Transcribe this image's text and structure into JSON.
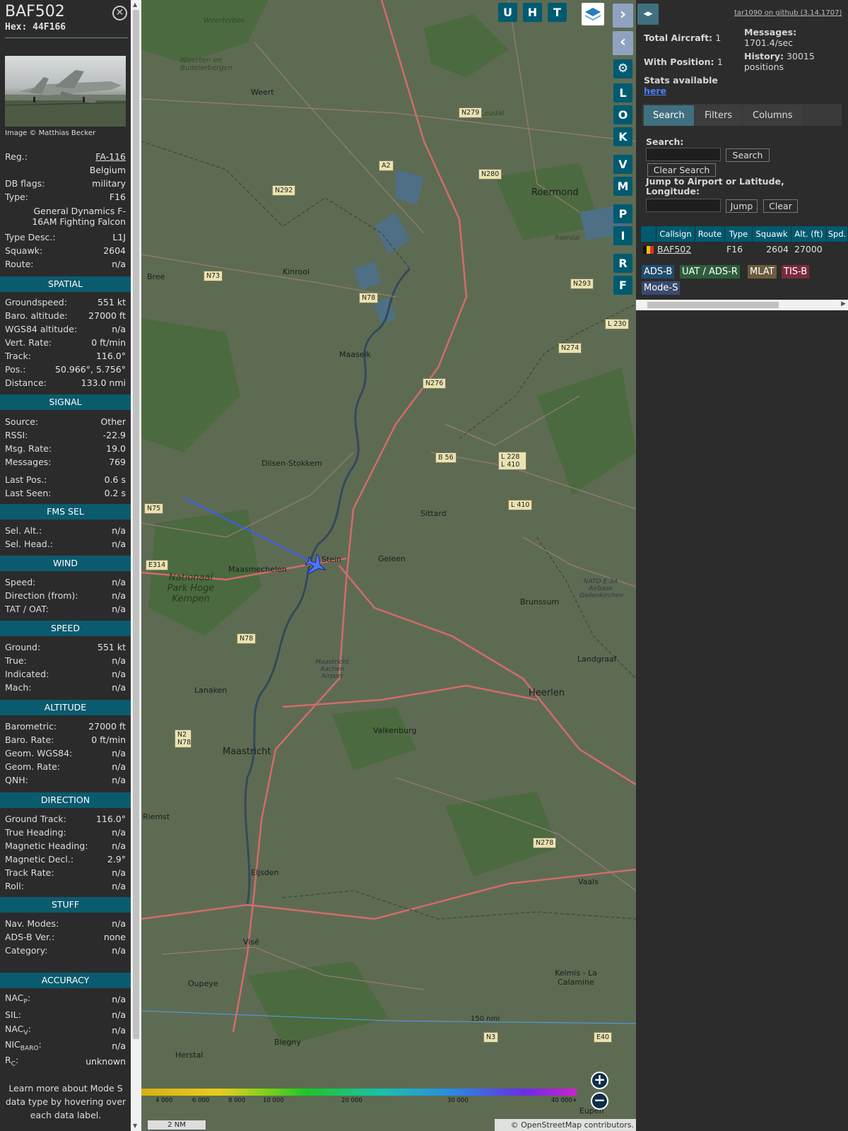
{
  "sidebar": {
    "callsign": "BAF502",
    "hex_label": "Hex:",
    "hex_value": "44F166",
    "photo_credit": "Image © Matthias Becker",
    "top_rows": [
      {
        "label": "Reg.:",
        "value": "FA-116"
      },
      {
        "label": "",
        "value": "Belgium"
      },
      {
        "label": "DB flags:",
        "value": "military"
      },
      {
        "label": "Type:",
        "value": "F16"
      }
    ],
    "type_full": "General Dynamics F-16AM Fighting Falcon",
    "desc_rows": [
      {
        "label": "Type Desc.:",
        "value": "L1J"
      },
      {
        "label": "Squawk:",
        "value": "2604"
      },
      {
        "label": "Route:",
        "value": "n/a"
      }
    ],
    "sections": {
      "spatial": "SPATIAL",
      "signal": "SIGNAL",
      "fms": "FMS SEL",
      "wind": "WIND",
      "speed": "SPEED",
      "altitude": "ALTITUDE",
      "direction": "DIRECTION",
      "stuff": "STUFF",
      "accuracy": "ACCURACY"
    },
    "spatial": [
      {
        "label": "Groundspeed:",
        "value": "551 kt"
      },
      {
        "label": "Baro. altitude:",
        "value": "27000 ft"
      },
      {
        "label": "WGS84 altitude:",
        "value": "n/a"
      },
      {
        "label": "Vert. Rate:",
        "value": "0 ft/min"
      },
      {
        "label": "Track:",
        "value": "116.0°"
      },
      {
        "label": "Pos.:",
        "value": "50.966°, 5.756°"
      },
      {
        "label": "Distance:",
        "value": "133.0 nmi"
      }
    ],
    "signal": [
      {
        "label": "Source:",
        "value": "Other"
      },
      {
        "label": "RSSI:",
        "value": "-22.9"
      },
      {
        "label": "Msg. Rate:",
        "value": "19.0"
      },
      {
        "label": "Messages:",
        "value": "769"
      },
      {
        "label": "Last Pos.:",
        "value": "0.6 s"
      },
      {
        "label": "Last Seen:",
        "value": "0.2 s"
      }
    ],
    "fms": [
      {
        "label": "Sel. Alt.:",
        "value": "n/a"
      },
      {
        "label": "Sel. Head.:",
        "value": "n/a"
      }
    ],
    "wind": [
      {
        "label": "Speed:",
        "value": "n/a"
      },
      {
        "label": "Direction (from):",
        "value": "n/a"
      },
      {
        "label": "TAT / OAT:",
        "value": "n/a"
      }
    ],
    "speed": [
      {
        "label": "Ground:",
        "value": "551 kt"
      },
      {
        "label": "True:",
        "value": "n/a"
      },
      {
        "label": "Indicated:",
        "value": "n/a"
      },
      {
        "label": "Mach:",
        "value": "n/a"
      }
    ],
    "altitude": [
      {
        "label": "Barometric:",
        "value": "27000 ft"
      },
      {
        "label": "Baro. Rate:",
        "value": "0 ft/min"
      },
      {
        "label": "Geom. WGS84:",
        "value": "n/a"
      },
      {
        "label": "Geom. Rate:",
        "value": "n/a"
      },
      {
        "label": "QNH:",
        "value": "n/a"
      }
    ],
    "direction": [
      {
        "label": "Ground Track:",
        "value": "116.0°"
      },
      {
        "label": "True Heading:",
        "value": "n/a"
      },
      {
        "label": "Magnetic Heading:",
        "value": "n/a"
      },
      {
        "label": "Magnetic Decl.:",
        "value": "2.9°"
      },
      {
        "label": "Track Rate:",
        "value": "n/a"
      },
      {
        "label": "Roll:",
        "value": "n/a"
      }
    ],
    "stuff": [
      {
        "label": "Nav. Modes:",
        "value": "n/a"
      },
      {
        "label": "ADS-B Ver.:",
        "value": "none"
      },
      {
        "label": "Category:",
        "value": "n/a"
      }
    ],
    "accuracy": [
      {
        "label": "NAC",
        "sub": "P",
        "value": "n/a"
      },
      {
        "label": "SIL:",
        "sub": "",
        "value": "n/a"
      },
      {
        "label": "NAC",
        "sub": "V",
        "value": "n/a"
      },
      {
        "label": "NIC",
        "sub": "BARO",
        "value": "n/a"
      },
      {
        "label": "R",
        "sub": "C",
        "value": "unknown"
      }
    ],
    "learn_more": "Learn more about Mode S data type by hovering over each data label."
  },
  "map": {
    "top_buttons": [
      "U",
      "H",
      "T"
    ],
    "side_buttons": [
      "L",
      "O",
      "K",
      "V",
      "M",
      "P",
      "I",
      "R",
      "F"
    ],
    "towns": [
      {
        "name": "Weert"
      },
      {
        "name": "Roermond"
      },
      {
        "name": "Kinrooi"
      },
      {
        "name": "Bree"
      },
      {
        "name": "Maaseik"
      },
      {
        "name": "Dilsen-Stokkem"
      },
      {
        "name": "Sittard"
      },
      {
        "name": "Geleen"
      },
      {
        "name": "Stein"
      },
      {
        "name": "Maasmechelen"
      },
      {
        "name": "Brunssum"
      },
      {
        "name": "Landgraaf"
      },
      {
        "name": "Heerlen"
      },
      {
        "name": "Lanaken"
      },
      {
        "name": "Valkenburg"
      },
      {
        "name": "Maastricht"
      },
      {
        "name": "Riemst"
      },
      {
        "name": "Eijsden"
      },
      {
        "name": "Vaals"
      },
      {
        "name": "Visé"
      },
      {
        "name": "Oupeye"
      },
      {
        "name": "Kelmis - La Calamine"
      },
      {
        "name": "Blegny"
      },
      {
        "name": "Herstal"
      },
      {
        "name": "Eupen"
      },
      {
        "name": "Weerterbos"
      },
      {
        "name": "Weerter- en Budelerbergen"
      },
      {
        "name": "Leudal"
      },
      {
        "name": "Nationaal Park Hoge Kempen"
      },
      {
        "name": "Maastricht Aachen Airport"
      },
      {
        "name": "NATO E-3A Airbase Geilenkirchen"
      },
      {
        "name": "Roerdal"
      }
    ],
    "roads": [
      "N279",
      "A2",
      "N280",
      "N292",
      "N73",
      "N78",
      "N293",
      "N274",
      "N276",
      "B 56",
      "L 228 L 410",
      "L 410",
      "N75",
      "E314",
      "N78",
      "N2 N78",
      "N278",
      "N3",
      "E40",
      "L 230"
    ],
    "range_ring_label": "150 nmi",
    "colorbar_ticks": [
      "4 000",
      "6 000",
      "8 000",
      "10 000",
      "20 000",
      "30 000",
      "40 000+"
    ],
    "scale_label": "2 NM",
    "attribution": "© OpenStreetMap contributors."
  },
  "panel": {
    "github_link": "tar1090 on github (3.14.1707)",
    "total_aircraft_label": "Total Aircraft:",
    "total_aircraft_value": "1",
    "with_position_label": "With Position:",
    "with_position_value": "1",
    "messages_label": "Messages:",
    "messages_value": "1701.4/sec",
    "history_label": "History:",
    "history_value": "30015 positions",
    "stats_label": "Stats available",
    "stats_link": "here",
    "tabs": [
      "Search",
      "Filters",
      "Columns"
    ],
    "search_label": "Search:",
    "search_button": "Search",
    "clear_search_button": "Clear Search",
    "jump_label": "Jump to Airport or Latitude, Longitude:",
    "jump_button": "Jump",
    "clear_button": "Clear",
    "table_headers": [
      "Callsign",
      "Route",
      "Type",
      "Squawk",
      "Alt. (ft)",
      "Spd."
    ],
    "table_row": {
      "callsign": "BAF502",
      "route": "",
      "type": "F16",
      "squawk": "2604",
      "alt": "27000"
    },
    "legend_tags": [
      "ADS-B",
      "UAT / ADS-R",
      "MLAT",
      "TIS-B",
      "Mode-S"
    ]
  },
  "colors": {
    "section_header": "#0b5b6e",
    "button": "#005a70",
    "track_line": "#3a5bff",
    "tag_adsb": "#1f4c6e",
    "tag_uat": "#2d5d3a",
    "tag_mlat": "#6b5b3e",
    "tag_tisb": "#7a2b3b",
    "tag_modes": "#3a4a6e"
  }
}
